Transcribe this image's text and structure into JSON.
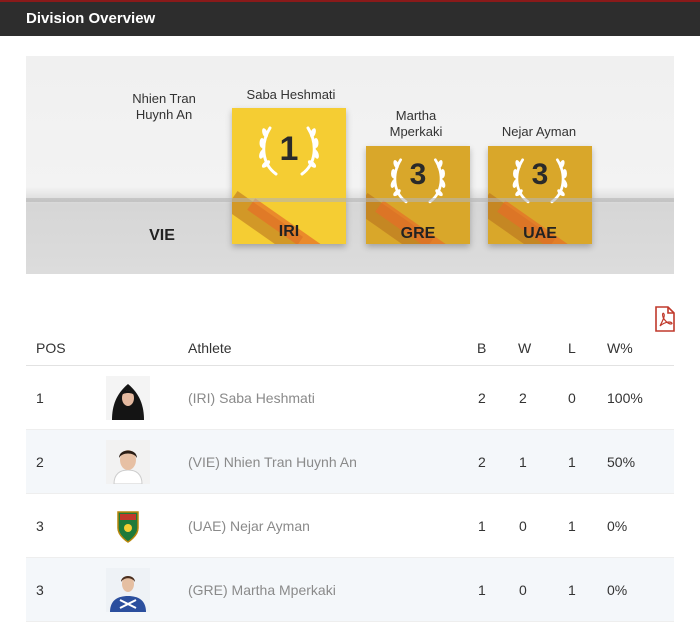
{
  "header": {
    "title": "Division Overview"
  },
  "podium": {
    "names": {
      "fourth": "Nhien Tran\nHuynh An",
      "first": "Saba Heshmati",
      "third_a": "Martha\nMperkaki",
      "third_b": "Nejar Ayman"
    },
    "countries": {
      "fourth": "VIE",
      "first": "IRI",
      "third_a": "GRE",
      "third_b": "UAE"
    },
    "ranks": {
      "first": "1",
      "third_a": "3",
      "third_b": "3"
    },
    "colors": {
      "gold": "#f5cd33",
      "bronze": "#d9a72a"
    }
  },
  "table": {
    "headers": {
      "pos": "POS",
      "athlete": "Athlete",
      "b": "B",
      "w": "W",
      "l": "L",
      "wpct": "W%"
    },
    "rows": [
      {
        "pos": "1",
        "athlete": "(IRI) Saba Heshmati",
        "b": "2",
        "w": "2",
        "l": "0",
        "wpct": "100%"
      },
      {
        "pos": "2",
        "athlete": "(VIE) Nhien Tran Huynh An",
        "b": "2",
        "w": "1",
        "l": "1",
        "wpct": "50%"
      },
      {
        "pos": "3",
        "athlete": "(UAE) Nejar Ayman",
        "b": "1",
        "w": "0",
        "l": "1",
        "wpct": "0%"
      },
      {
        "pos": "3",
        "athlete": "(GRE) Martha Mperkaki",
        "b": "1",
        "w": "0",
        "l": "1",
        "wpct": "0%"
      }
    ]
  },
  "icons": {
    "export": "pdf-icon"
  }
}
